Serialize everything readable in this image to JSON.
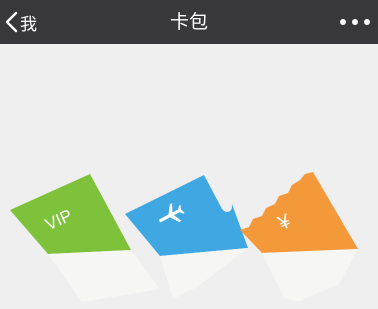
{
  "nav": {
    "back_label": "我",
    "title": "卡包",
    "back_icon": "chevron-left-icon",
    "more_icon": "more-dots-icon"
  },
  "cards": [
    {
      "kind": "vip",
      "label": "VIP",
      "color": "#7ec13a"
    },
    {
      "kind": "ticket",
      "icon": "airplane-icon",
      "color": "#3fa8e3"
    },
    {
      "kind": "coupon",
      "label": "¥",
      "color": "#f4993a"
    }
  ],
  "colors": {
    "nav_bg": "#38383a",
    "page_bg": "#efeff0",
    "card_bottom": "#f6f6f4"
  }
}
